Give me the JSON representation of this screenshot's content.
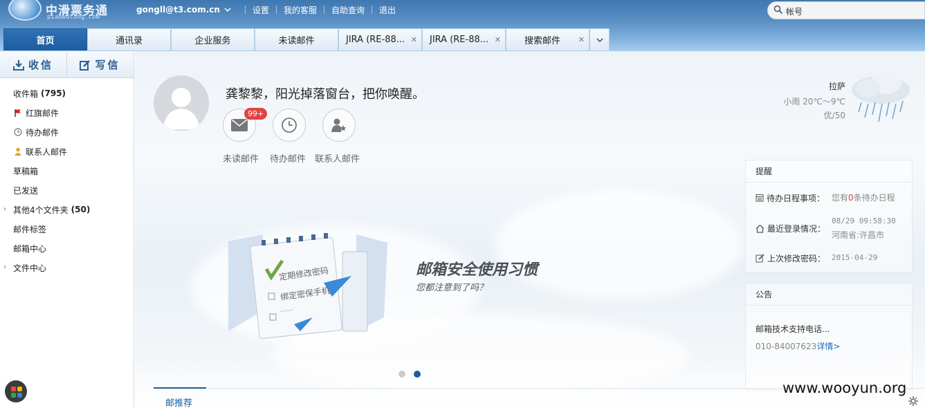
{
  "brand": {
    "name": "中滑票务通",
    "sub": "piaowutong.com"
  },
  "header": {
    "email": "gongll@t3.com.cn",
    "links": [
      "设置",
      "我的客服",
      "自助查询",
      "退出"
    ],
    "search_placeholder": "帐号"
  },
  "tabs": [
    {
      "label": "首页",
      "active": true,
      "closable": false
    },
    {
      "label": "通讯录",
      "active": false,
      "closable": false
    },
    {
      "label": "企业服务",
      "active": false,
      "closable": false
    },
    {
      "label": "未读邮件",
      "active": false,
      "closable": false
    },
    {
      "label": "JIRA (RE-88...",
      "active": false,
      "closable": true
    },
    {
      "label": "JIRA (RE-88...",
      "active": false,
      "closable": true
    },
    {
      "label": "搜索邮件",
      "active": false,
      "closable": true
    }
  ],
  "tab_more_icon": "chevron-down-icon",
  "sidebar": {
    "receive": "收信",
    "compose": "写信",
    "folders": [
      {
        "label": "收件箱",
        "count": "(795)",
        "icon": ""
      },
      {
        "label": "红旗邮件",
        "count": "",
        "icon": "flag-icon"
      },
      {
        "label": "待办邮件",
        "count": "",
        "icon": "clock-icon"
      },
      {
        "label": "联系人邮件",
        "count": "",
        "icon": "person-icon"
      },
      {
        "label": "草稿箱",
        "count": "",
        "icon": ""
      },
      {
        "label": "已发送",
        "count": "",
        "icon": ""
      },
      {
        "label": "其他4个文件夹",
        "count": "(50)",
        "icon": "",
        "expandable": true
      },
      {
        "label": "邮件标签",
        "count": "",
        "icon": ""
      },
      {
        "label": "邮箱中心",
        "count": "",
        "icon": ""
      },
      {
        "label": "文件中心",
        "count": "",
        "icon": "",
        "expandable": true
      }
    ]
  },
  "welcome": {
    "greeting": "龚黎黎，阳光掉落窗台，把你唤醒。",
    "shortcuts": [
      {
        "label": "未读邮件",
        "badge": "99+",
        "icon": "mail-icon"
      },
      {
        "label": "待办邮件",
        "badge": "",
        "icon": "clock-icon"
      },
      {
        "label": "联系人邮件",
        "badge": "",
        "icon": "contact-star-icon"
      }
    ]
  },
  "weather": {
    "city": "拉萨",
    "condition": "小雨 20℃～9℃",
    "aqi": "优/50"
  },
  "reminder": {
    "title": "提醒",
    "todo_label": "待办日程事项：",
    "todo_pre": "您有",
    "todo_count": "0",
    "todo_post": "条待办日程",
    "login_label": "最近登录情况：",
    "login_time": "08/29 09:58:30",
    "login_place": "河南省:许昌市",
    "pwd_label": "上次修改密码：",
    "pwd_date": "2015-04-29"
  },
  "notice": {
    "title": "公告",
    "line1": "邮箱技术支持电话...",
    "phone": "010-84007623",
    "link": "详情>"
  },
  "banner": {
    "title": "邮箱安全使用习惯",
    "subtitle": "您都注意到了吗？",
    "note_line1": "定期修改密码",
    "note_line2": "绑定密保手机",
    "note_line3": "......",
    "active_slide": 2,
    "slides": 2
  },
  "recommend": {
    "tab": "邮推荐"
  },
  "watermark": "www.wooyun.org",
  "colors": {
    "accent": "#1d5c9f",
    "badge": "#e04343",
    "header": "#3f77b0"
  }
}
